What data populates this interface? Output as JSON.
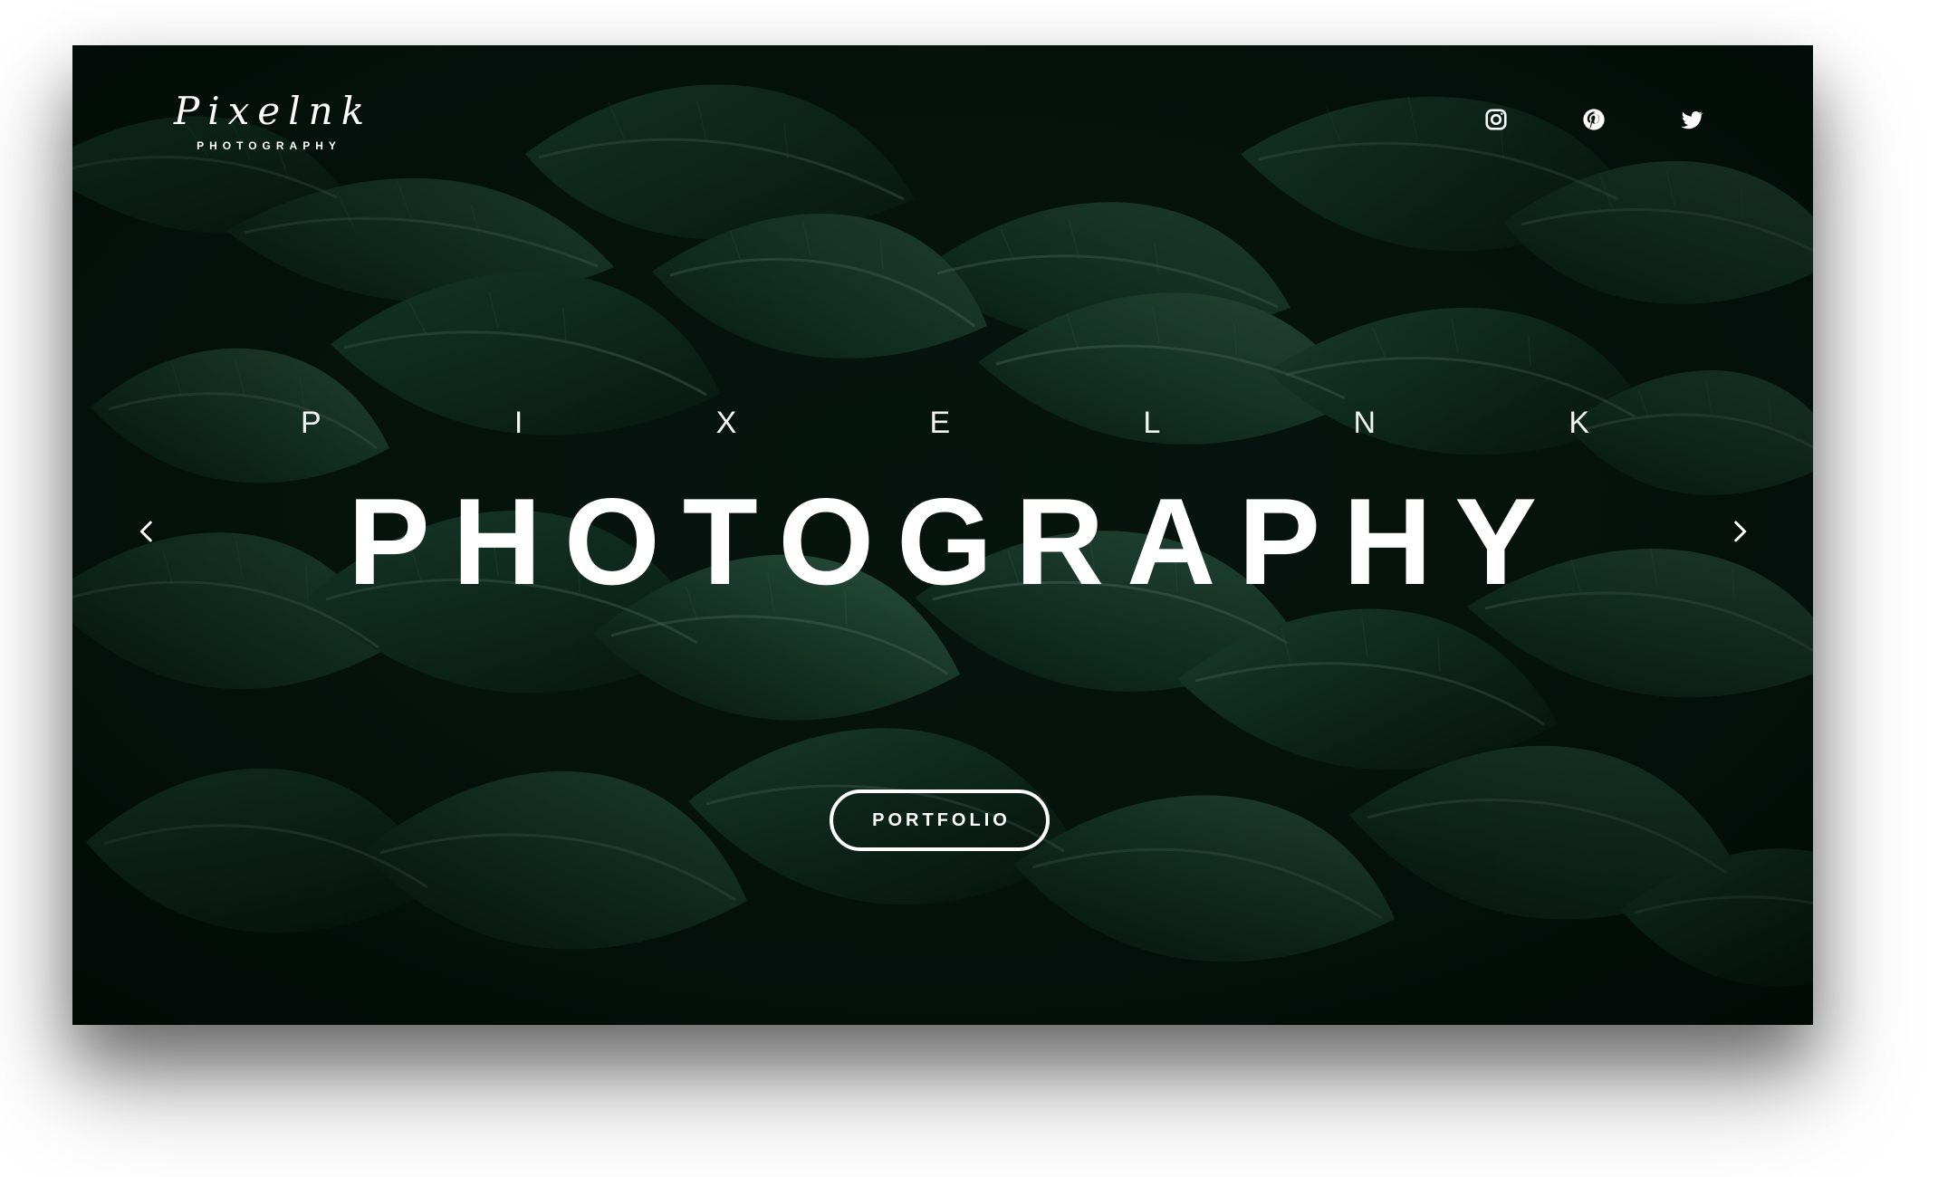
{
  "brand": {
    "script_name": "Pixelnk",
    "subtitle": "PHOTOGRAPHY"
  },
  "social": {
    "items": [
      {
        "icon": "instagram-icon"
      },
      {
        "icon": "pinterest-icon"
      },
      {
        "icon": "twitter-icon"
      }
    ]
  },
  "hero": {
    "kicker_letters": [
      "P",
      "I",
      "X",
      "E",
      "L",
      "N",
      "K"
    ],
    "headline": "PHOTOGRAPHY",
    "cta_label": "PORTFOLIO"
  },
  "navigation": {
    "previous_icon": "chevron-left-icon",
    "next_icon": "chevron-right-icon"
  },
  "colors": {
    "text": "#ffffff",
    "background": "#07110c",
    "leaf_dark": "#0f2a1d",
    "leaf_mid": "#1d4a35",
    "leaf_light": "#5f8e76"
  }
}
